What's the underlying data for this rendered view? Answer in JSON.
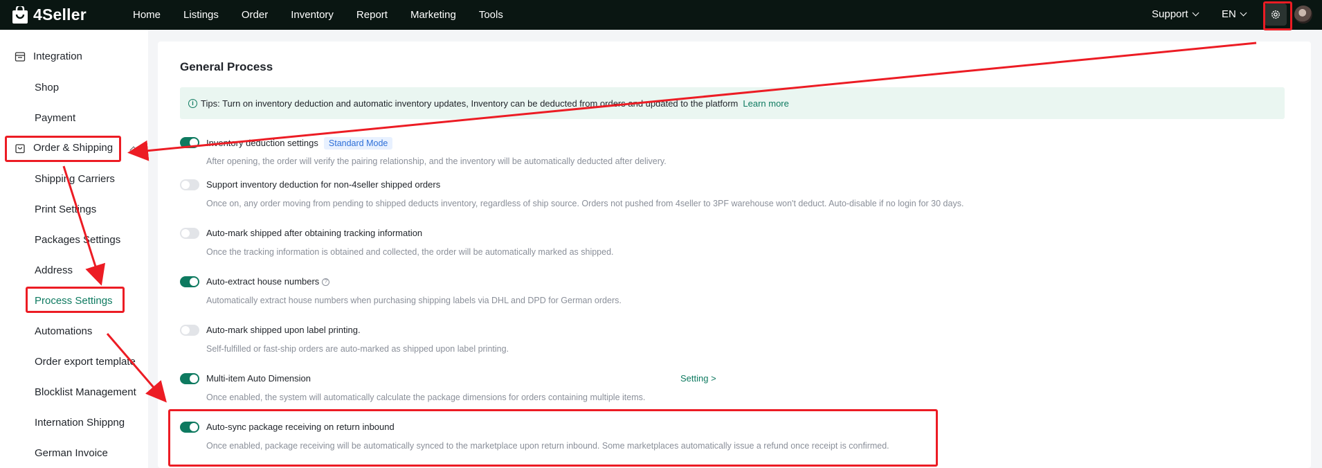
{
  "app": {
    "brand": "4Seller"
  },
  "nav": {
    "items": [
      "Home",
      "Listings",
      "Order",
      "Inventory",
      "Report",
      "Marketing",
      "Tools"
    ],
    "support": "Support",
    "language": "EN"
  },
  "sidebar": {
    "groups": [
      {
        "label": "Integration",
        "icon": "integration-icon"
      },
      {
        "label": "Order & Shipping",
        "icon": "order-bag-icon"
      }
    ],
    "integration_items": [
      "Shop",
      "Payment"
    ],
    "order_items": [
      "Shipping Carriers",
      "Print Settings",
      "Packages Settings",
      "Address",
      "Process Settings",
      "Automations",
      "Order export template",
      "Blocklist Management",
      "Internation Shippng",
      "German Invoice"
    ],
    "active_item": "Process Settings"
  },
  "main": {
    "title": "General Process",
    "tips": {
      "text": "Tips: Turn on inventory deduction and automatic inventory updates, Inventory can be deducted from orders and updated to the platform",
      "link": "Learn more"
    },
    "settings": [
      {
        "label": "Inventory deduction settings",
        "on": true,
        "badge": "Standard Mode",
        "desc": "After opening, the order will verify the pairing relationship, and the inventory will be automatically deducted after delivery."
      },
      {
        "label": "Support inventory deduction for non-4seller shipped orders",
        "on": false,
        "desc": "Once on, any order moving from pending to shipped deducts inventory, regardless of ship source. Orders not pushed from 4seller to 3PF warehouse won't deduct. Auto-disable if no login for 30 days."
      },
      {
        "label": "Auto-mark shipped after obtaining tracking information",
        "on": false,
        "desc": "Once the tracking information is obtained and collected, the order will be automatically marked as shipped."
      },
      {
        "label": "Auto-extract house numbers",
        "on": true,
        "help": "?",
        "desc": "Automatically extract house numbers when purchasing shipping labels via DHL and DPD for German orders."
      },
      {
        "label": "Auto-mark shipped upon label printing.",
        "on": false,
        "desc": "Self-fulfilled or fast-ship orders are auto-marked as shipped upon label printing."
      },
      {
        "label": "Multi-item Auto Dimension",
        "on": true,
        "link": "Setting >",
        "desc": "Once enabled, the system will automatically calculate the package dimensions for orders containing multiple items."
      },
      {
        "label": "Auto-sync package receiving on return inbound",
        "on": true,
        "desc": "Once enabled, package receiving will be automatically synced to the marketplace upon return inbound. Some marketplaces automatically issue a refund once receipt is confirmed."
      }
    ]
  },
  "colors": {
    "topbar": "#0a1612",
    "accent": "#0e7a60",
    "annotation": "#ec1c24"
  }
}
